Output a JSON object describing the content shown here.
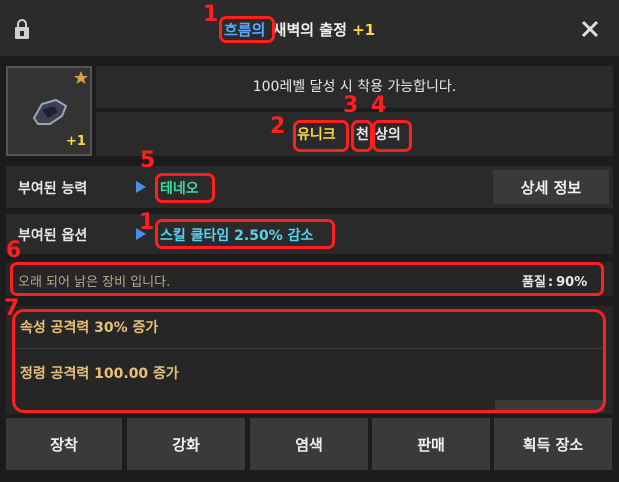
{
  "header": {
    "title_prefix": "흐름의",
    "title_rest": "새벽의 출정",
    "title_plus": "+1",
    "lock_icon": "lock-icon",
    "close_icon": "close-icon"
  },
  "item": {
    "level_note": "100레벨 달성 시 착용 가능합니다.",
    "plus_badge": "+1",
    "star_icon": "star-icon",
    "rarity": "유니크",
    "material": "천",
    "slot": "상의"
  },
  "ability": {
    "label": "부여된 능력",
    "value": "테네오",
    "detail_button": "상세 정보"
  },
  "option": {
    "label": "부여된 옵션",
    "value": "스킬 쿨타임 2.50% 감소"
  },
  "quality": {
    "desc": "오래 되어 낡은 장비 입니다.",
    "label": "품질",
    "sep": ":",
    "value": "90%"
  },
  "stats": [
    "속성 공격력 30% 증가",
    "정령 공격력 100.00 증가"
  ],
  "annotations": [
    "1",
    "2",
    "3",
    "4",
    "5",
    "1",
    "6",
    "7"
  ],
  "buttons": {
    "equip": "장착",
    "enhance": "강화",
    "dye": "염색",
    "sell": "판매",
    "source": "획득 장소"
  },
  "colors": {
    "accent_blue": "#5aa9ff",
    "ability_green": "#3fd9a0",
    "rarity_yellow": "#ffd84a",
    "option_cyan": "#56d3f0",
    "stat_tan": "#e8c07a",
    "annotation_red": "#ff1f1f"
  }
}
